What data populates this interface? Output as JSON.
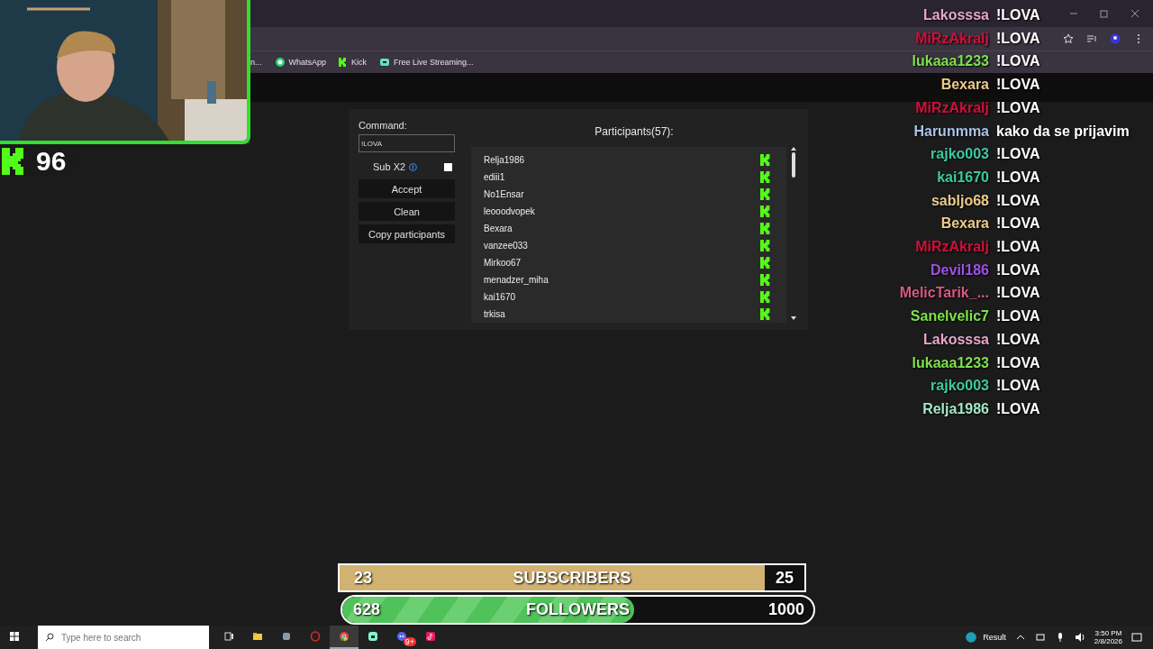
{
  "bookmarks": [
    "n...",
    "WhatsApp",
    "Kick",
    "Free Live Streaming..."
  ],
  "follower_counter": {
    "count": "96"
  },
  "command_panel": {
    "label": "Command:",
    "value": "!LOVA",
    "sub_x2": {
      "label": "Sub X2",
      "checked": false
    },
    "buttons": [
      "Accept",
      "Clean",
      "Copy participants"
    ]
  },
  "participants": {
    "title": "Participants(57):",
    "items": [
      "Relja1986",
      "ediii1",
      "No1Ensar",
      "leooodvopek",
      "Bexara",
      "vanzee033",
      "Mirkoo67",
      "menadzer_miha",
      "kai1670",
      "trkisa"
    ]
  },
  "chat": [
    {
      "user": "Lakosssa",
      "color": "#e8a8c8",
      "message": "!LOVA"
    },
    {
      "user": "MiRzAkralj",
      "color": "#d0103a",
      "message": "!LOVA"
    },
    {
      "user": "lukaaa1233",
      "color": "#7ee04a",
      "message": "!LOVA"
    },
    {
      "user": "Bexara",
      "color": "#eccb8a",
      "message": "!LOVA"
    },
    {
      "user": "MiRzAkralj",
      "color": "#d0103a",
      "message": "!LOVA"
    },
    {
      "user": "Harunmma",
      "color": "#a8c4ea",
      "message": "kako da se prijavim"
    },
    {
      "user": "rajko003",
      "color": "#3ec8a0",
      "message": "!LOVA"
    },
    {
      "user": "kai1670",
      "color": "#3ec8a0",
      "message": "!LOVA"
    },
    {
      "user": "sabljo68",
      "color": "#eccb8a",
      "message": "!LOVA"
    },
    {
      "user": "Bexara",
      "color": "#eccb8a",
      "message": "!LOVA"
    },
    {
      "user": "MiRzAkralj",
      "color": "#d0103a",
      "message": "!LOVA"
    },
    {
      "user": "Devil186",
      "color": "#a050e8",
      "message": "!LOVA"
    },
    {
      "user": "MelicTarik_...",
      "color": "#d65a7e",
      "message": "!LOVA"
    },
    {
      "user": "Sanelvelic7",
      "color": "#7ee04a",
      "message": "!LOVA"
    },
    {
      "user": "Lakosssa",
      "color": "#e8a8c8",
      "message": "!LOVA"
    },
    {
      "user": "lukaaa1233",
      "color": "#7ee04a",
      "message": "!LOVA"
    },
    {
      "user": "rajko003",
      "color": "#3ec8a0",
      "message": "!LOVA"
    },
    {
      "user": "Relja1986",
      "color": "#a0e8c8",
      "message": "!LOVA"
    }
  ],
  "goals": [
    {
      "kind": "subscribers",
      "current": "23",
      "label": "SUBSCRIBERS",
      "target": "25",
      "level": 0.915
    },
    {
      "kind": "followers",
      "current": "628",
      "label": "FOLLOWERS",
      "target": "1000",
      "level": 0.62
    }
  ],
  "taskbar": {
    "search_placeholder": "Type here to search",
    "apps": [
      {
        "active": false
      },
      {
        "active": false
      },
      {
        "active": false
      },
      {
        "active": false
      },
      {
        "active": true
      },
      {
        "active": false
      },
      {
        "active": false,
        "badge": "9+"
      },
      {
        "active": false
      }
    ],
    "weather": "Result",
    "time": "3:50 PM",
    "date": "2/8/2026"
  }
}
